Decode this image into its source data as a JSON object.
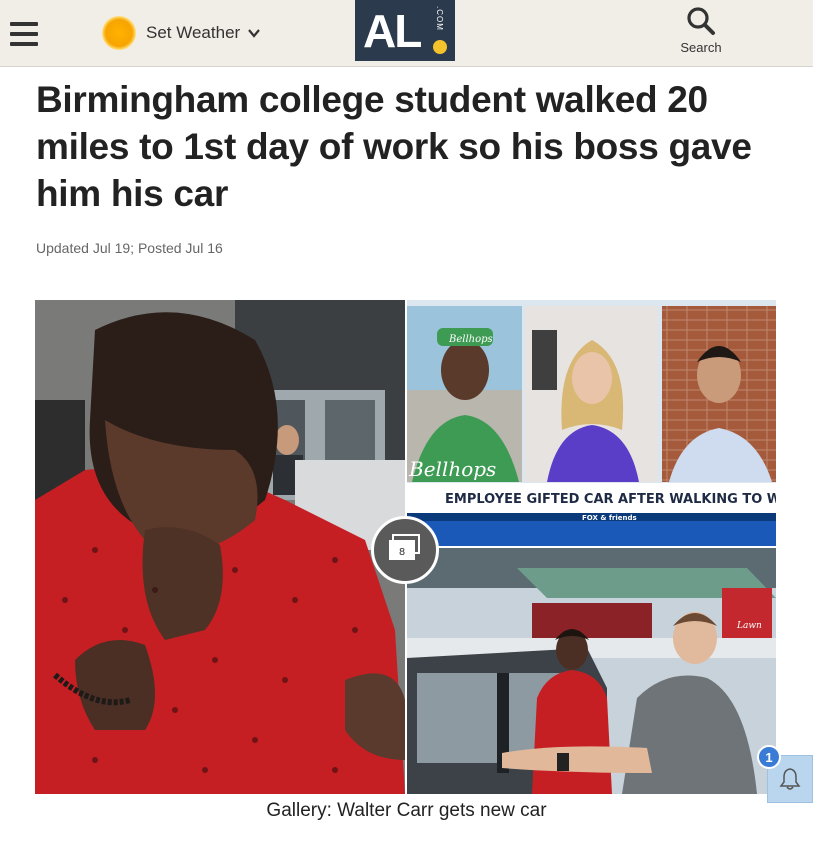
{
  "header": {
    "menu_icon": "hamburger-menu-icon",
    "weather": {
      "label": "Set Weather",
      "icon": "sun-icon"
    },
    "logo": {
      "text": "AL",
      "suffix": ".COM",
      "accent": "#f4c22b",
      "background": "#2c3a4d"
    },
    "search": {
      "label": "Search",
      "icon": "search-icon"
    }
  },
  "article": {
    "headline": "Birmingham college student walked 20 miles to 1st day of work so his boss gave him his car",
    "dateline": "Updated Jul 19; Posted Jul 16"
  },
  "gallery": {
    "count": "8",
    "caption": "Gallery: Walter Carr gets new car",
    "tv_chyron": "EMPLOYEE GIFTED CAR AFTER WALKING TO WORK",
    "tv_network": "FOX & friends",
    "shirt_text": "Bellhops",
    "cap_text": "Bellhops",
    "sign_text": "Lawn"
  },
  "notifications": {
    "count": "1",
    "icon": "bell-icon",
    "accent": "#3a7bd5"
  }
}
